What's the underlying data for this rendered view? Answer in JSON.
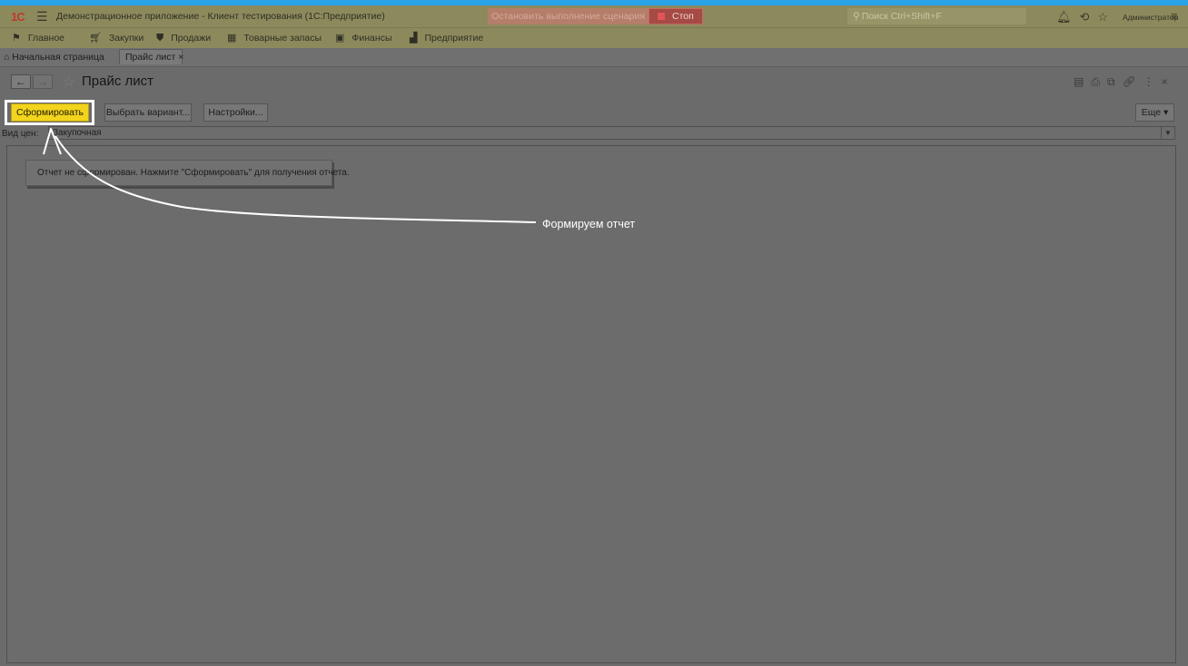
{
  "titlebar": {
    "logo": "1С",
    "title": "Демонстрационное приложение - Клиент тестирования (1С:Предприятие)",
    "stop_message": "Остановить выполнение сценария",
    "stop_button": "Стоп",
    "search_placeholder": "Поиск Ctrl+Shift+F",
    "user": "Администратор"
  },
  "sections": [
    {
      "label": "Главное",
      "icon": "flag-icon"
    },
    {
      "label": "Закупки",
      "icon": "cart-icon"
    },
    {
      "label": "Продажи",
      "icon": "bag-icon"
    },
    {
      "label": "Товарные запасы",
      "icon": "grid-icon"
    },
    {
      "label": "Финансы",
      "icon": "finance-icon"
    },
    {
      "label": "Предприятие",
      "icon": "factory-icon"
    }
  ],
  "tabs": {
    "home": "Начальная страница",
    "active": "Прайс лист"
  },
  "form": {
    "title": "Прайс лист",
    "buttons": {
      "generate": "Сформировать",
      "variant": "Выбрать вариант...",
      "settings": "Настройки...",
      "more": "Еще"
    },
    "filter_label": "Вид цен:",
    "filter_value": "Закупочная",
    "report_message": "Отчет не сформирован. Нажмите \"Сформировать\" для получения отчета."
  },
  "callout": {
    "text": "Формируем отчет"
  },
  "colors": {
    "accent": "#29a4e9",
    "highlight_button": "#f2d41c",
    "stop_button": "#a54a45"
  }
}
